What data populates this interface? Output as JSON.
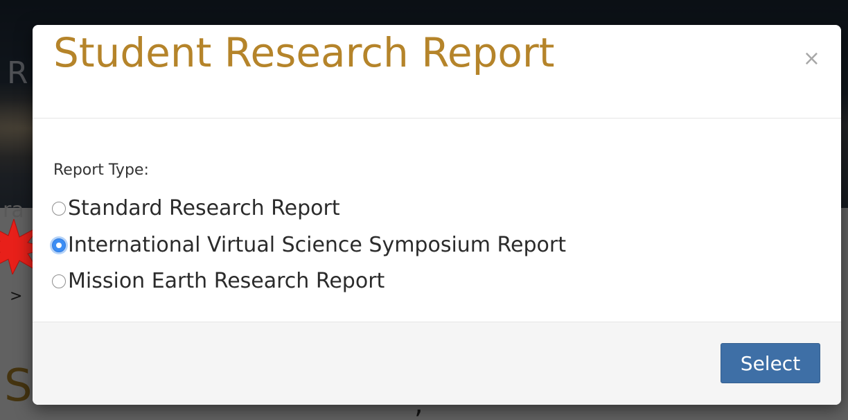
{
  "modal": {
    "title": "Student Research Report",
    "close_glyph": "×",
    "field_label": "Report Type:",
    "options": [
      {
        "label": "Standard Research Report",
        "checked": false
      },
      {
        "label": "International Virtual Science Symposium Report",
        "checked": true
      },
      {
        "label": "Mission Earth Research Report",
        "checked": false
      }
    ],
    "select_label": "Select"
  },
  "colors": {
    "title": "#b5842a",
    "button": "#3e6fa6",
    "radio_checked": "#3b8df4",
    "annotation_star": "#e8201a"
  },
  "icons": {
    "close": "close-icon",
    "annotation": "star-annotation-icon"
  }
}
